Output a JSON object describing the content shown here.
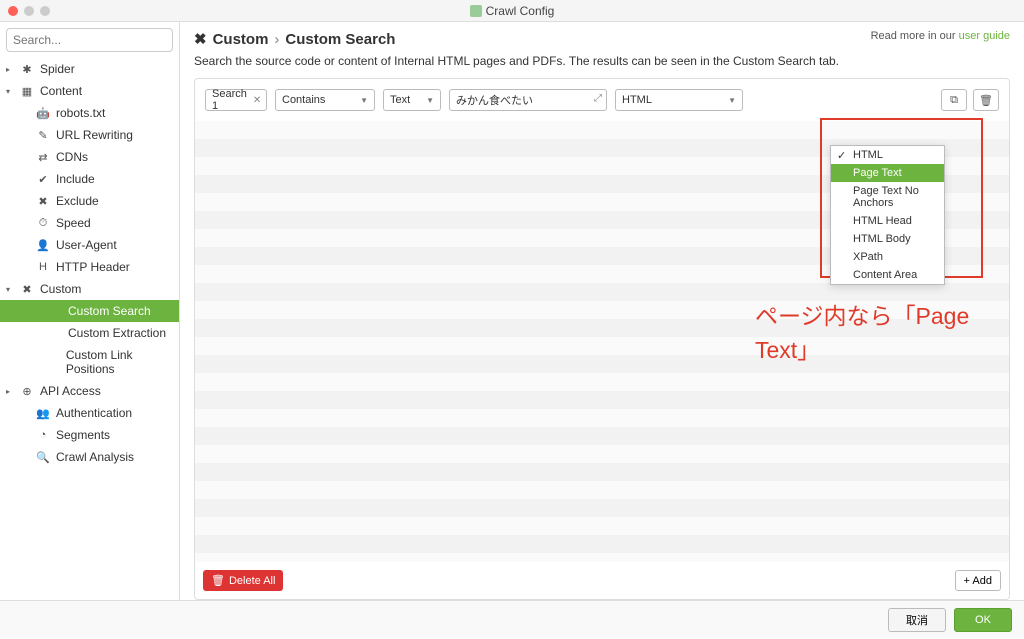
{
  "window": {
    "title": "Crawl Config"
  },
  "sidebar": {
    "search_placeholder": "Search...",
    "items": [
      {
        "label": "Spider",
        "icon": "✱",
        "caret": "▸",
        "indent": 0
      },
      {
        "label": "Content",
        "icon": "▦",
        "caret": "▾",
        "indent": 0
      },
      {
        "label": "robots.txt",
        "icon": "🤖",
        "caret": "",
        "indent": 1
      },
      {
        "label": "URL Rewriting",
        "icon": "✎",
        "caret": "",
        "indent": 1
      },
      {
        "label": "CDNs",
        "icon": "⇄",
        "caret": "",
        "indent": 1
      },
      {
        "label": "Include",
        "icon": "✔",
        "caret": "",
        "indent": 1
      },
      {
        "label": "Exclude",
        "icon": "✖",
        "caret": "",
        "indent": 1
      },
      {
        "label": "Speed",
        "icon": "⏱",
        "caret": "",
        "indent": 1
      },
      {
        "label": "User-Agent",
        "icon": "👤",
        "caret": "",
        "indent": 1
      },
      {
        "label": "HTTP Header",
        "icon": "H",
        "caret": "",
        "indent": 1
      },
      {
        "label": "Custom",
        "icon": "✖",
        "caret": "▾",
        "indent": 0
      },
      {
        "label": "Custom Search",
        "icon": "",
        "caret": "",
        "indent": 2,
        "selected": true
      },
      {
        "label": "Custom Extraction",
        "icon": "",
        "caret": "",
        "indent": 2
      },
      {
        "label": "Custom Link Positions",
        "icon": "",
        "caret": "",
        "indent": 2
      },
      {
        "label": "API Access",
        "icon": "⊕",
        "caret": "▸",
        "indent": 0
      },
      {
        "label": "Authentication",
        "icon": "👥",
        "caret": "",
        "indent": 1
      },
      {
        "label": "Segments",
        "icon": "◔",
        "caret": "",
        "indent": 1
      },
      {
        "label": "Crawl Analysis",
        "icon": "🔍",
        "caret": "",
        "indent": 1
      }
    ]
  },
  "header": {
    "icon": "✖",
    "crumb1": "Custom",
    "sep": "›",
    "crumb2": "Custom Search",
    "readmore_prefix": "Read more in our ",
    "readmore_link": "user guide"
  },
  "description": "Search the source code or content of Internal HTML pages and PDFs. The results can be seen in the Custom Search tab.",
  "row": {
    "search_name": "Search 1",
    "filter": "Contains",
    "type": "Text",
    "query": "みかん食べたい",
    "searchtype": "HTML"
  },
  "dropdown": {
    "options": [
      "HTML",
      "Page Text",
      "Page Text No Anchors",
      "HTML Head",
      "HTML Body",
      "XPath",
      "Content Area"
    ],
    "checked": "HTML",
    "highlighted": "Page Text"
  },
  "annotation_text": "ページ内なら「Page Text」",
  "buttons": {
    "delete_all": "Delete All",
    "add": "+ Add",
    "cancel": "取消",
    "ok": "OK"
  }
}
